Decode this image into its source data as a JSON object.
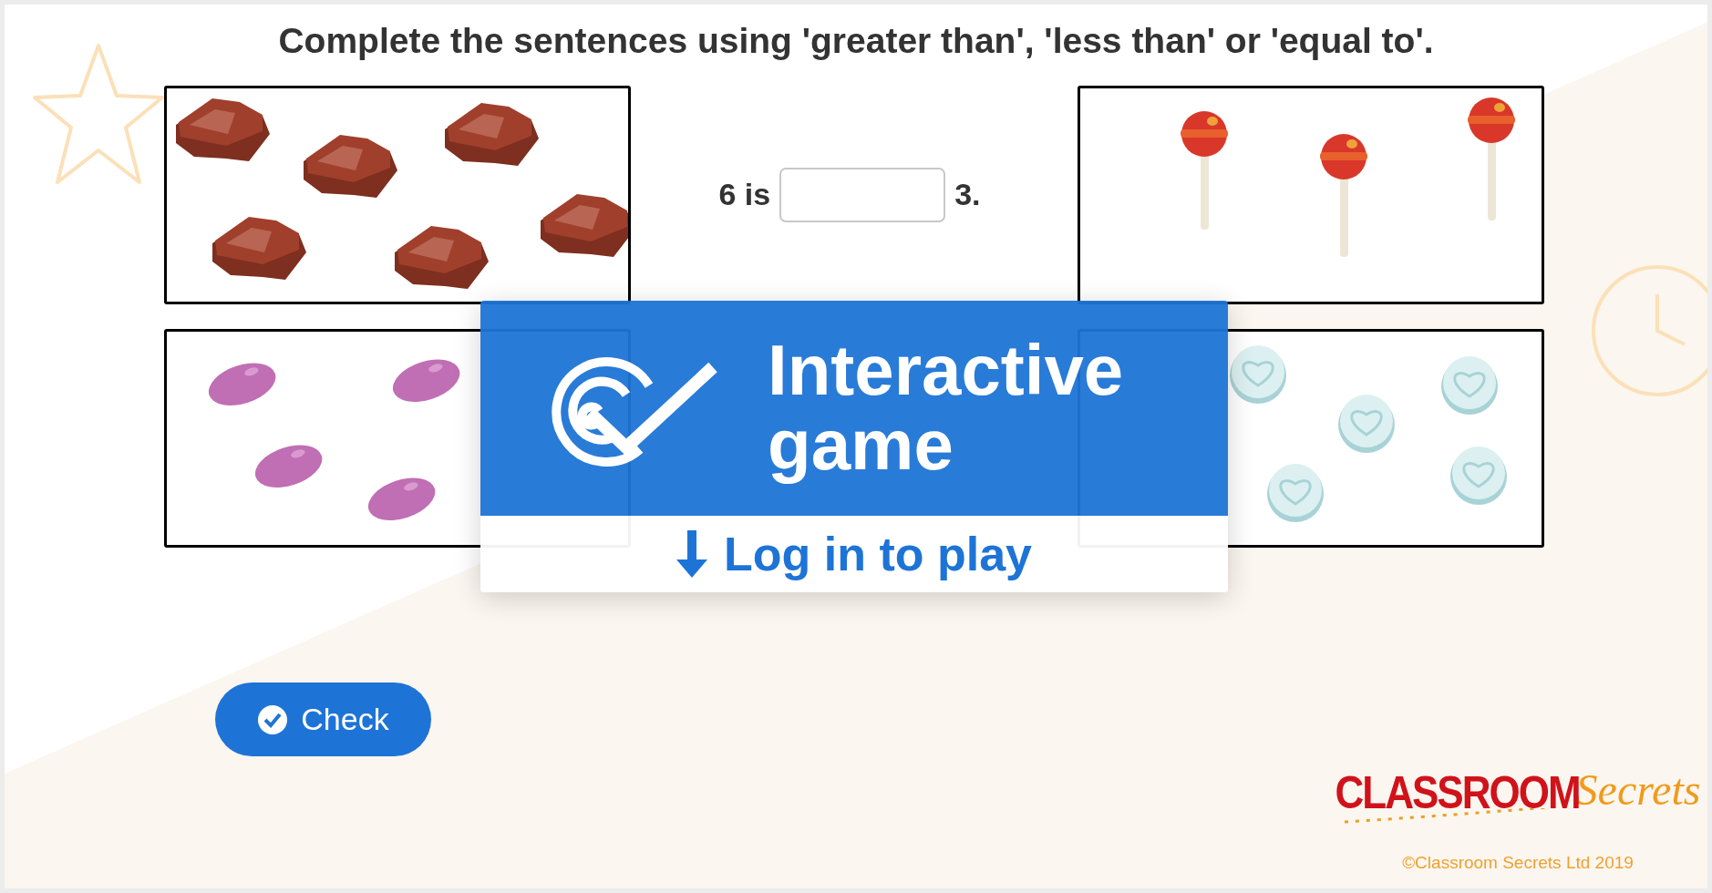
{
  "instruction": "Complete the sentences using 'greater than', 'less than' or 'equal to'.",
  "questions": [
    {
      "left_picture": {
        "kind": "chocolate"
      },
      "prefix": "6 is",
      "suffix": "3.",
      "right_picture": {
        "kind": "lollipop"
      }
    },
    {
      "left_picture": {
        "kind": "jellybean"
      },
      "right_picture": {
        "kind": "heart_sweet"
      }
    }
  ],
  "overlay": {
    "title": "Interactive game",
    "action": "Log in to play"
  },
  "check_button": {
    "label": "Check"
  },
  "footer": {
    "logo_primary": "CLASSROOM",
    "logo_secondary": "Secrets",
    "copyright": "©Classroom Secrets Ltd 2019"
  }
}
